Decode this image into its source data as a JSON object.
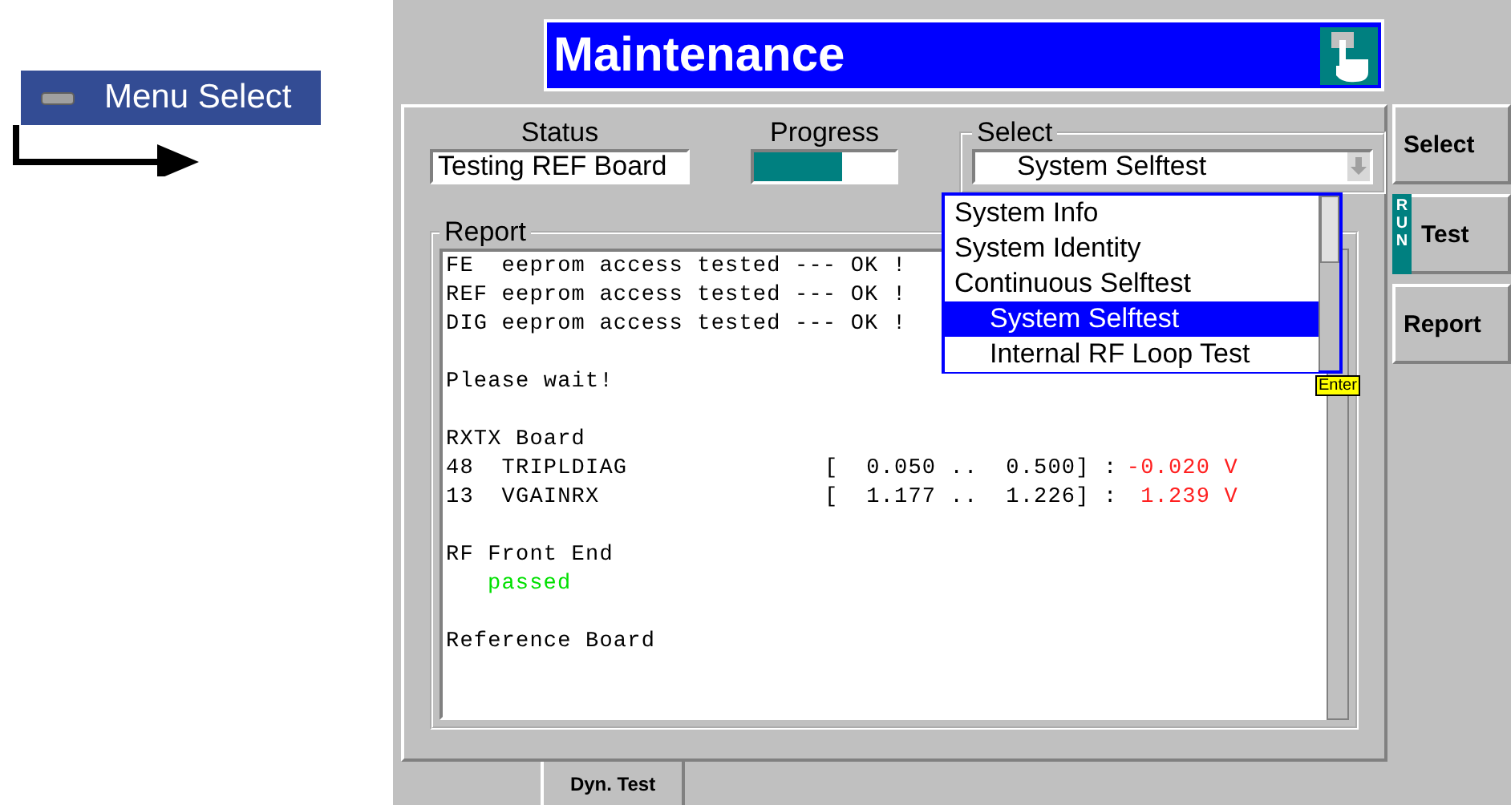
{
  "menu_select": {
    "label": "Menu Select"
  },
  "window": {
    "title": "Maintenance"
  },
  "status": {
    "label": "Status",
    "value": "Testing REF Board"
  },
  "progress": {
    "label": "Progress",
    "level": 0.63
  },
  "select": {
    "label": "Select",
    "value": "System Selftest",
    "expanded": true,
    "options": [
      {
        "label": "System Info",
        "indented": false,
        "selected": false
      },
      {
        "label": "System Identity",
        "indented": false,
        "selected": false
      },
      {
        "label": "Continuous Selftest",
        "indented": false,
        "selected": false
      },
      {
        "label": "System Selftest",
        "indented": true,
        "selected": true
      },
      {
        "label": "Internal RF Loop Test",
        "indented": true,
        "selected": false
      }
    ]
  },
  "enter_tag": "Enter",
  "report": {
    "label": "Report",
    "lines": [
      {
        "kind": "text",
        "text": "FE  eeprom access tested --- OK !"
      },
      {
        "kind": "text",
        "text": "REF eeprom access tested --- OK !"
      },
      {
        "kind": "text",
        "text": "DIG eeprom access tested --- OK !"
      },
      {
        "kind": "blank"
      },
      {
        "kind": "text",
        "text": "Please wait!"
      },
      {
        "kind": "blank"
      },
      {
        "kind": "text",
        "text": "RXTX Board"
      },
      {
        "kind": "measurement",
        "label": "48  TRIPLDIAG",
        "range": "[  0.050 ..  0.500] :",
        "value": "-0.020 V",
        "failed": true
      },
      {
        "kind": "measurement",
        "label": "13  VGAINRX",
        "range": "[  1.177 ..  1.226] :",
        "value": "1.239 V",
        "failed": true
      },
      {
        "kind": "blank"
      },
      {
        "kind": "text",
        "text": "RF Front End"
      },
      {
        "kind": "result",
        "text": "passed",
        "passed": true
      },
      {
        "kind": "blank"
      },
      {
        "kind": "text",
        "text": "Reference Board"
      }
    ]
  },
  "softkeys": [
    {
      "label": "Select",
      "running": false
    },
    {
      "label": "Test",
      "running": true,
      "badge": "RUN"
    },
    {
      "label": "Report",
      "running": false
    }
  ],
  "tabs": [
    {
      "label": "Dyn. Test",
      "selected": true
    }
  ]
}
